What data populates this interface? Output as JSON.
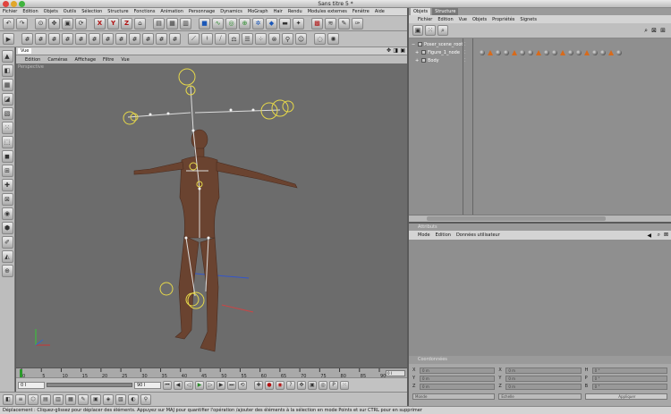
{
  "window": {
    "title": "Sans titre 5 *"
  },
  "menubar": [
    "Fichier",
    "Edition",
    "Objets",
    "Outils",
    "Sélection",
    "Structure",
    "Fonctions",
    "Animation",
    "Personnage",
    "Dynamics",
    "MoGraph",
    "Hair",
    "Rendu",
    "Modules externes",
    "Fenêtre",
    "Aide"
  ],
  "view": {
    "panel_label": "Vue",
    "menu": [
      "Edition",
      "Caméras",
      "Affichage",
      "Filtre",
      "Vue"
    ],
    "projection": "Perspective"
  },
  "timeline": {
    "ticks": [
      "0",
      "5",
      "10",
      "15",
      "20",
      "25",
      "30",
      "35",
      "40",
      "45",
      "50",
      "55",
      "60",
      "65",
      "70",
      "75",
      "80",
      "85",
      "90"
    ],
    "end_field": "0 I"
  },
  "playbar": {
    "start_field": "0 I",
    "end_field": "90 I"
  },
  "objects_panel": {
    "tabs": [
      "Objets",
      "Structure"
    ],
    "menu": [
      "Fichier",
      "Edition",
      "Vue",
      "Objets",
      "Propriétés",
      "Signets"
    ],
    "items": [
      {
        "name": "Poser_scene_root",
        "indent": 0
      },
      {
        "name": "Figure_1_node",
        "indent": 1
      },
      {
        "name": "Body",
        "indent": 1
      }
    ]
  },
  "attributes_panel": {
    "header": "Attributs",
    "menu": [
      "Mode",
      "Edition",
      "Données utilisateur"
    ]
  },
  "coordinates_panel": {
    "header": "Coordonnées",
    "rows": [
      {
        "axis": "X",
        "pos": "0 m",
        "size": "0 m",
        "rot_label": "H",
        "rot": "0 °"
      },
      {
        "axis": "Y",
        "pos": "0 m",
        "size": "0 m",
        "rot_label": "P",
        "rot": "0 °"
      },
      {
        "axis": "Z",
        "pos": "0 m",
        "size": "0 m",
        "rot_label": "B",
        "rot": "0 °"
      }
    ],
    "mode_select": "Monde",
    "scale_select": "Echelle",
    "apply_button": "Appliquer"
  },
  "statusbar": {
    "text": "Déplacement : Cliquez-glissez pour déplacer des éléments. Appuyez sur MAJ pour quantifier l'opération /ajouter des éléments à la sélection en mode Points et sur CTRL pour en supprimer"
  },
  "colors": {
    "viewport_bg": "#6c6c6c",
    "panel_bg": "#8f8f8f",
    "toolbar_bg": "#bfbfbf"
  }
}
